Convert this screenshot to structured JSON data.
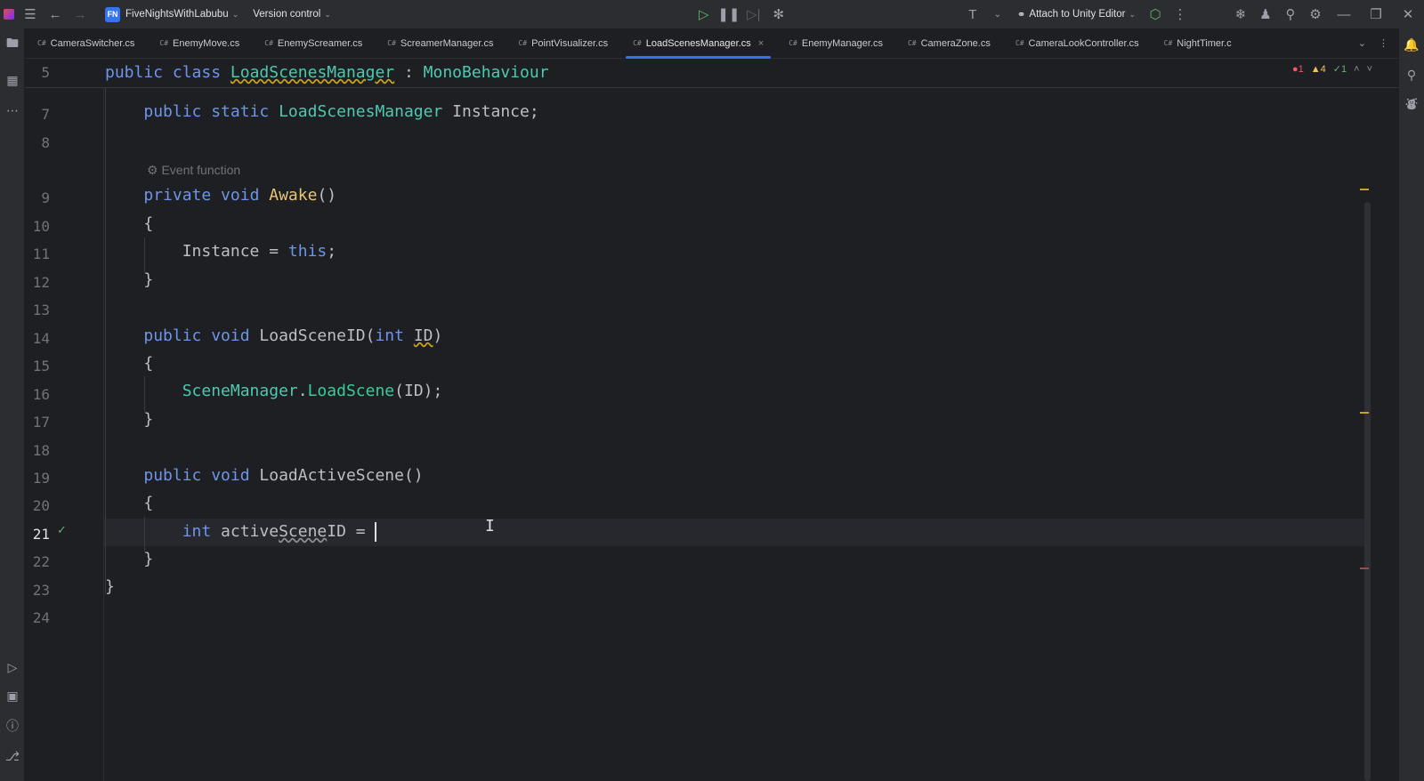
{
  "titlebar": {
    "project_badge": "FN",
    "project_name": "FiveNightsWithLabubu",
    "vcs": "Version control",
    "attach": "Attach to Unity Editor"
  },
  "tabs": [
    {
      "label": "CameraSwitcher.cs",
      "prefix": "C#"
    },
    {
      "label": "EnemyMove.cs",
      "prefix": "C#"
    },
    {
      "label": "EnemyScreamer.cs",
      "prefix": "C#"
    },
    {
      "label": "ScreamerManager.cs",
      "prefix": "C#"
    },
    {
      "label": "PointVisualizer.cs",
      "prefix": "C#"
    },
    {
      "label": "LoadScenesManager.cs",
      "prefix": "C#",
      "active": true,
      "close": "×"
    },
    {
      "label": "EnemyManager.cs",
      "prefix": "C#"
    },
    {
      "label": "CameraZone.cs",
      "prefix": "C#"
    },
    {
      "label": "CameraLookController.cs",
      "prefix": "C#"
    },
    {
      "label": "NightTimer.c",
      "prefix": "C#"
    }
  ],
  "inspections": {
    "errors": "1",
    "warnings": "4",
    "weak": "1"
  },
  "editor": {
    "sticky_line_no": "5",
    "sticky_line": {
      "kw1": "public",
      "kw2": "class",
      "cls": "LoadScenesManager",
      "colon": ":",
      "base": "MonoBehaviour"
    },
    "hint": "Event function",
    "line_numbers": [
      "7",
      "8",
      "9",
      "10",
      "11",
      "12",
      "13",
      "14",
      "15",
      "16",
      "17",
      "18",
      "19",
      "20",
      "21",
      "22",
      "23",
      "24"
    ],
    "lines": {
      "l7": {
        "kw": "public static",
        "type": "LoadScenesManager",
        "rest": " Instance;"
      },
      "l9": {
        "kw": "private void",
        "fn": "Awake",
        "rest": "()"
      },
      "l10": "{",
      "l11": {
        "id": "Instance",
        "eq": " = ",
        "kw": "this",
        "semi": ";"
      },
      "l12": "}",
      "l14": {
        "kw": "public void",
        "fn": " LoadSceneID(",
        "kw2": "int",
        "param": "ID",
        "close": ")"
      },
      "l15": "{",
      "l16": {
        "type": "SceneManager",
        "dot": ".",
        "fn": "LoadScene",
        "args": "(ID);"
      },
      "l17": "}",
      "l19": {
        "kw": "public void",
        "fn": " LoadActiveScene()"
      },
      "l20": "{",
      "l21": {
        "kw": "int",
        "pre": " active",
        "ul": "Scene",
        "post": "ID = "
      },
      "l22": "}",
      "l23": "}"
    }
  },
  "colors": {
    "accent": "#3574f0",
    "keyword": "#6c95eb",
    "type": "#4ec9b0",
    "error": "#f75464",
    "warning": "#f2c55c"
  }
}
